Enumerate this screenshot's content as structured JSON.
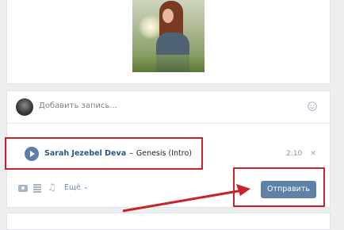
{
  "composer": {
    "placeholder": "Добавить запись...",
    "attachment": {
      "artist": "Sarah Jezebel Deva",
      "separator": "–",
      "title": "Genesis (Intro)",
      "duration": "2:10",
      "remove": "×"
    },
    "more_label": "Ещё",
    "more_chevron": "⌄",
    "note_glyph": "♫",
    "send_label": "Отправить"
  },
  "icons": {
    "photo_attach": "camera-icon",
    "video_attach": "film-icon",
    "audio_attach": "music-note-icon",
    "emoji": "smile-icon",
    "play": "play-icon",
    "remove": "close-icon"
  },
  "colors": {
    "accent": "#5e81a8",
    "highlight": "#c8232b",
    "link": "#2a5885",
    "background": "#edeef0"
  }
}
